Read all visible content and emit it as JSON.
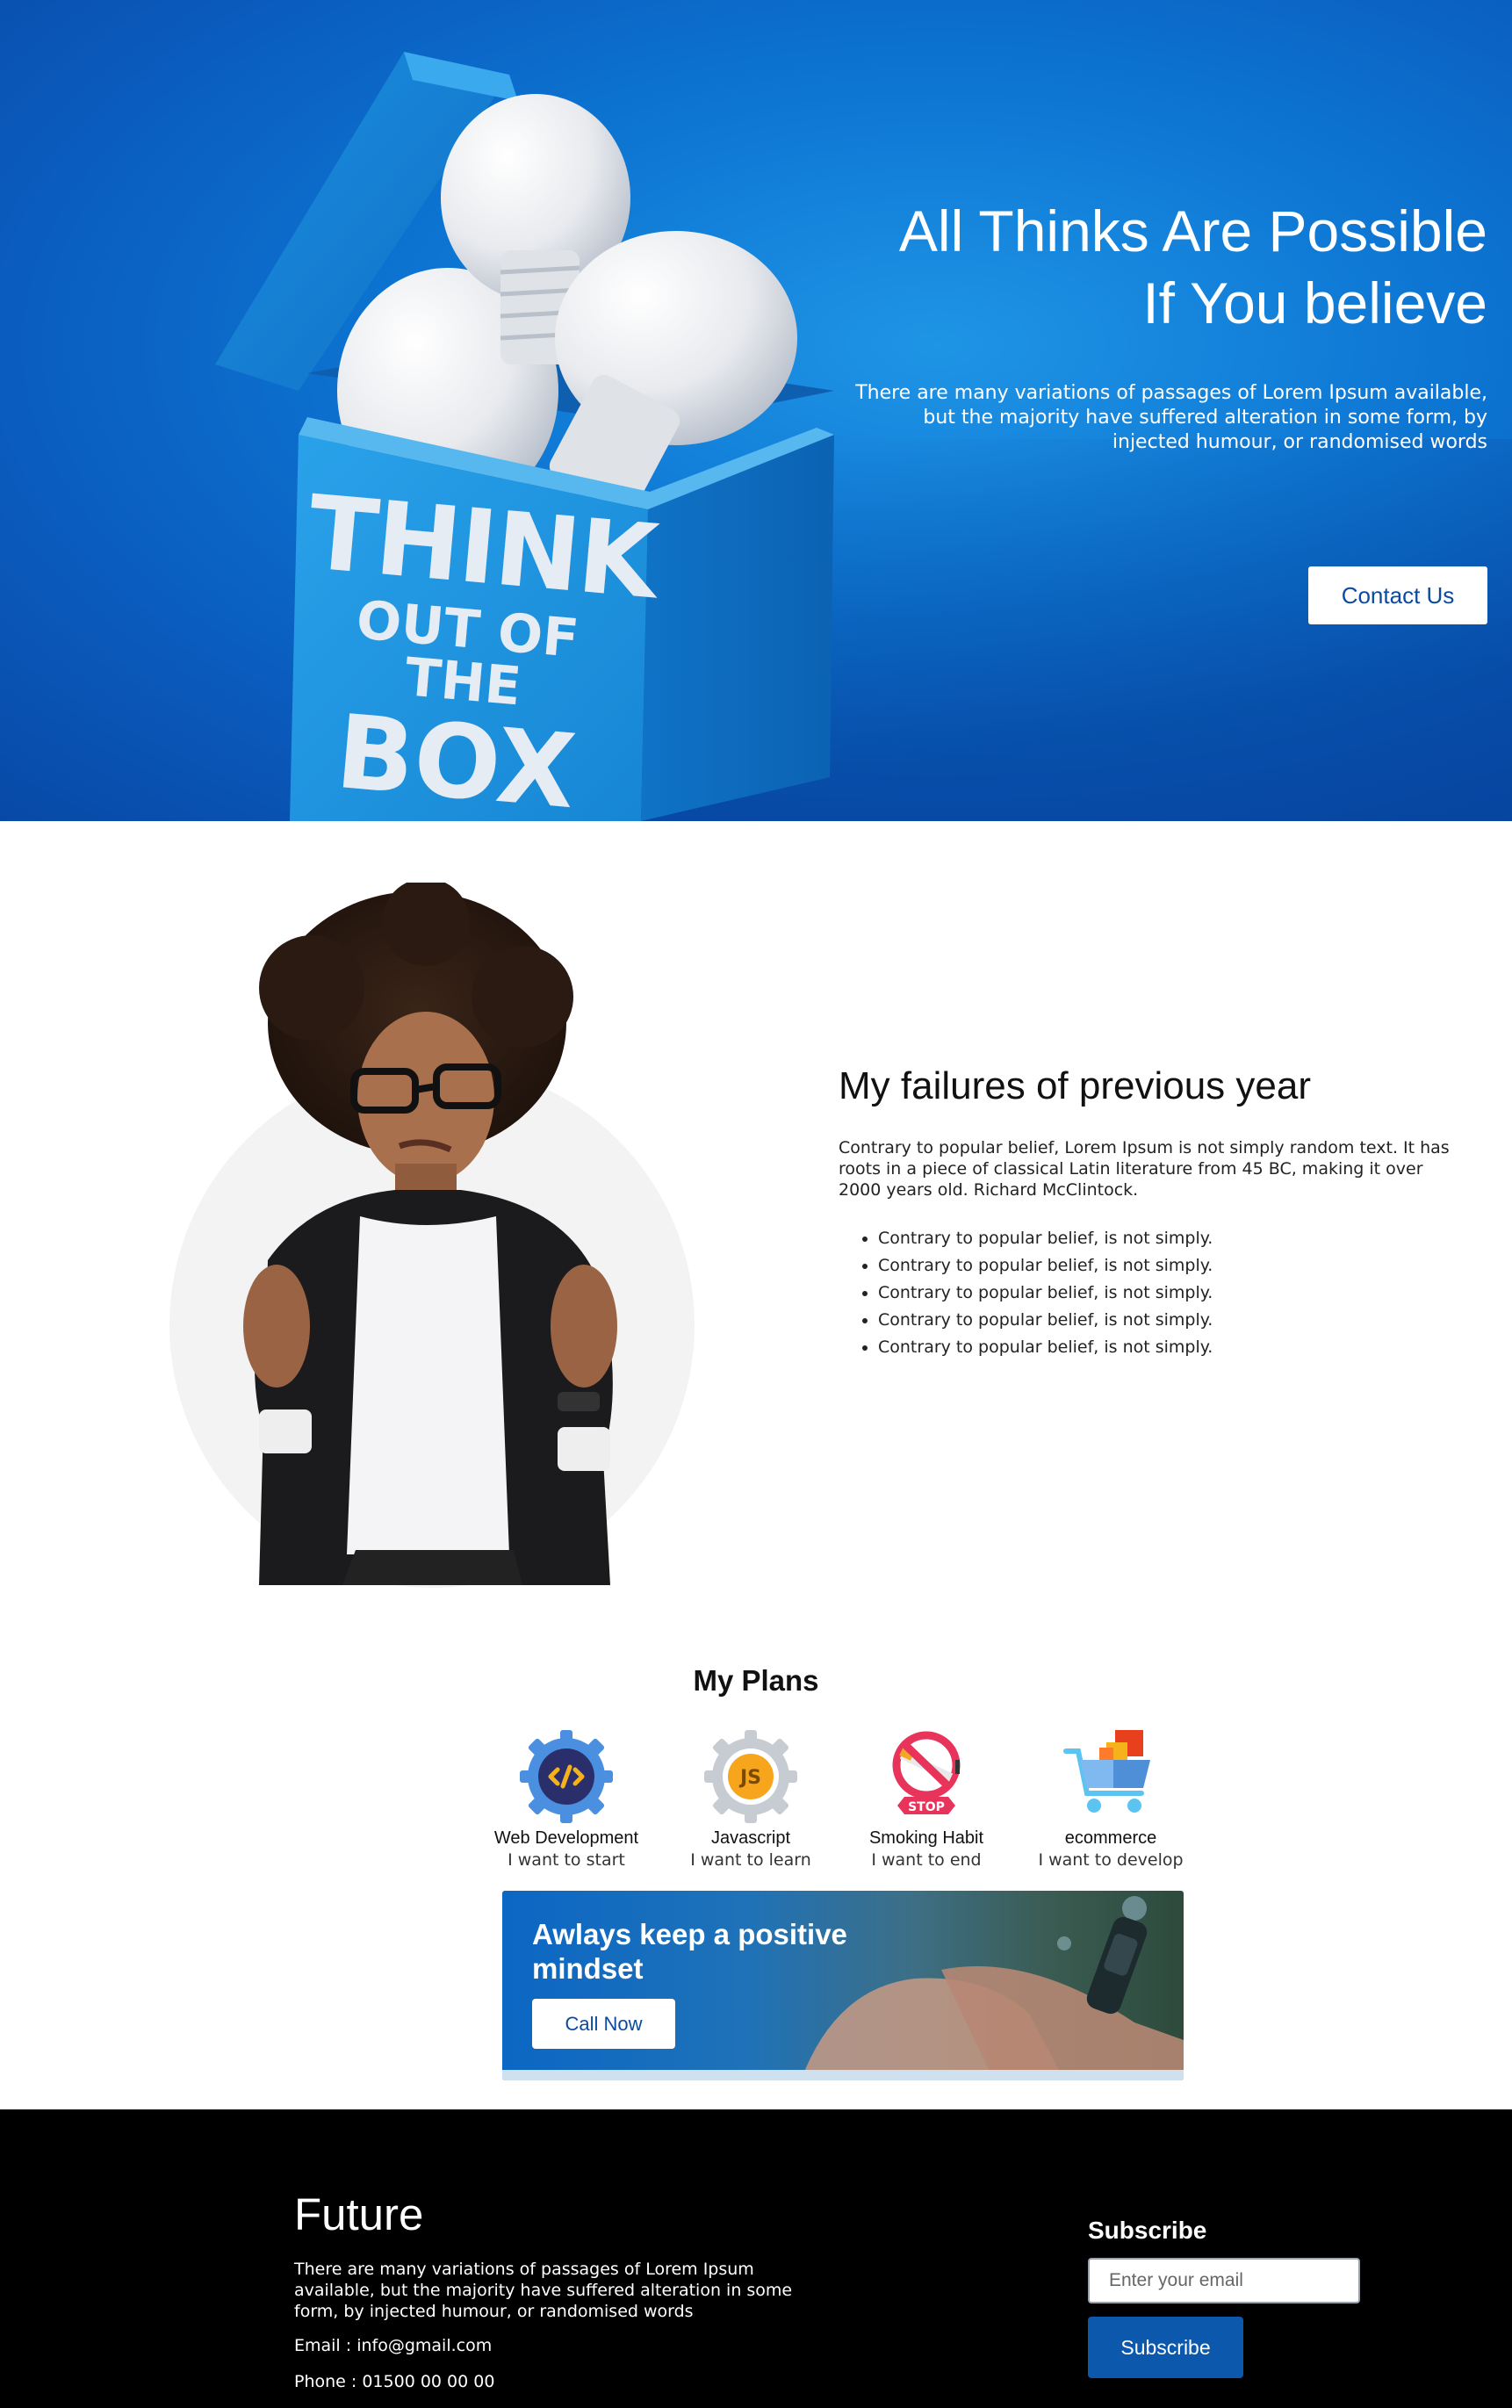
{
  "hero": {
    "box_text": [
      "THINK",
      "OUT OF THE",
      "BOX"
    ],
    "title": "All Thinks Are Possible If You believe",
    "subtitle": "There are many variations of passages of Lorem Ipsum available, but the majority have suffered alteration in some form, by injected humour, or randomised words",
    "cta_label": "Contact Us"
  },
  "failures": {
    "title": "My failures of previous year",
    "paragraph": "Contrary to popular belief, Lorem Ipsum is not simply random text. It has roots in a piece of classical Latin literature from 45 BC, making it over 2000 years old. Richard McClintock.",
    "items": [
      "Contrary to popular belief, is not simply.",
      "Contrary to popular belief, is not simply.",
      "Contrary to popular belief, is not simply.",
      "Contrary to popular belief, is not simply.",
      "Contrary to popular belief, is not simply."
    ]
  },
  "plans": {
    "title": "My Plans",
    "items": [
      {
        "name": "Web Development",
        "desc": "I want to start",
        "icon": "web-development-gear-icon"
      },
      {
        "name": "Javascript",
        "desc": "I want to learn",
        "icon": "javascript-gear-icon"
      },
      {
        "name": "Smoking Habit",
        "desc": "I want to end",
        "icon": "no-smoking-stop-icon",
        "icon_text": "STOP"
      },
      {
        "name": "ecommerce",
        "desc": "I want to develop",
        "icon": "shopping-cart-icon"
      }
    ],
    "js_icon_text": "JS"
  },
  "banner": {
    "title": "Awlays keep a positive mindset",
    "cta_label": "Call Now"
  },
  "footer": {
    "brand": "Future",
    "description": "There are many variations of passages of Lorem Ipsum available, but the majority have suffered alteration in some form, by injected humour, or randomised words",
    "email": "Email : info@gmail.com",
    "phone": "Phone : 01500 00 00 00",
    "subscribe_title": "Subscribe",
    "subscribe_placeholder": "Enter your email",
    "subscribe_button": "Subscribe"
  },
  "colors": {
    "hero_blue": "#0d76d3",
    "brand_blue": "#0b58ad",
    "footer_bg": "#000000"
  }
}
